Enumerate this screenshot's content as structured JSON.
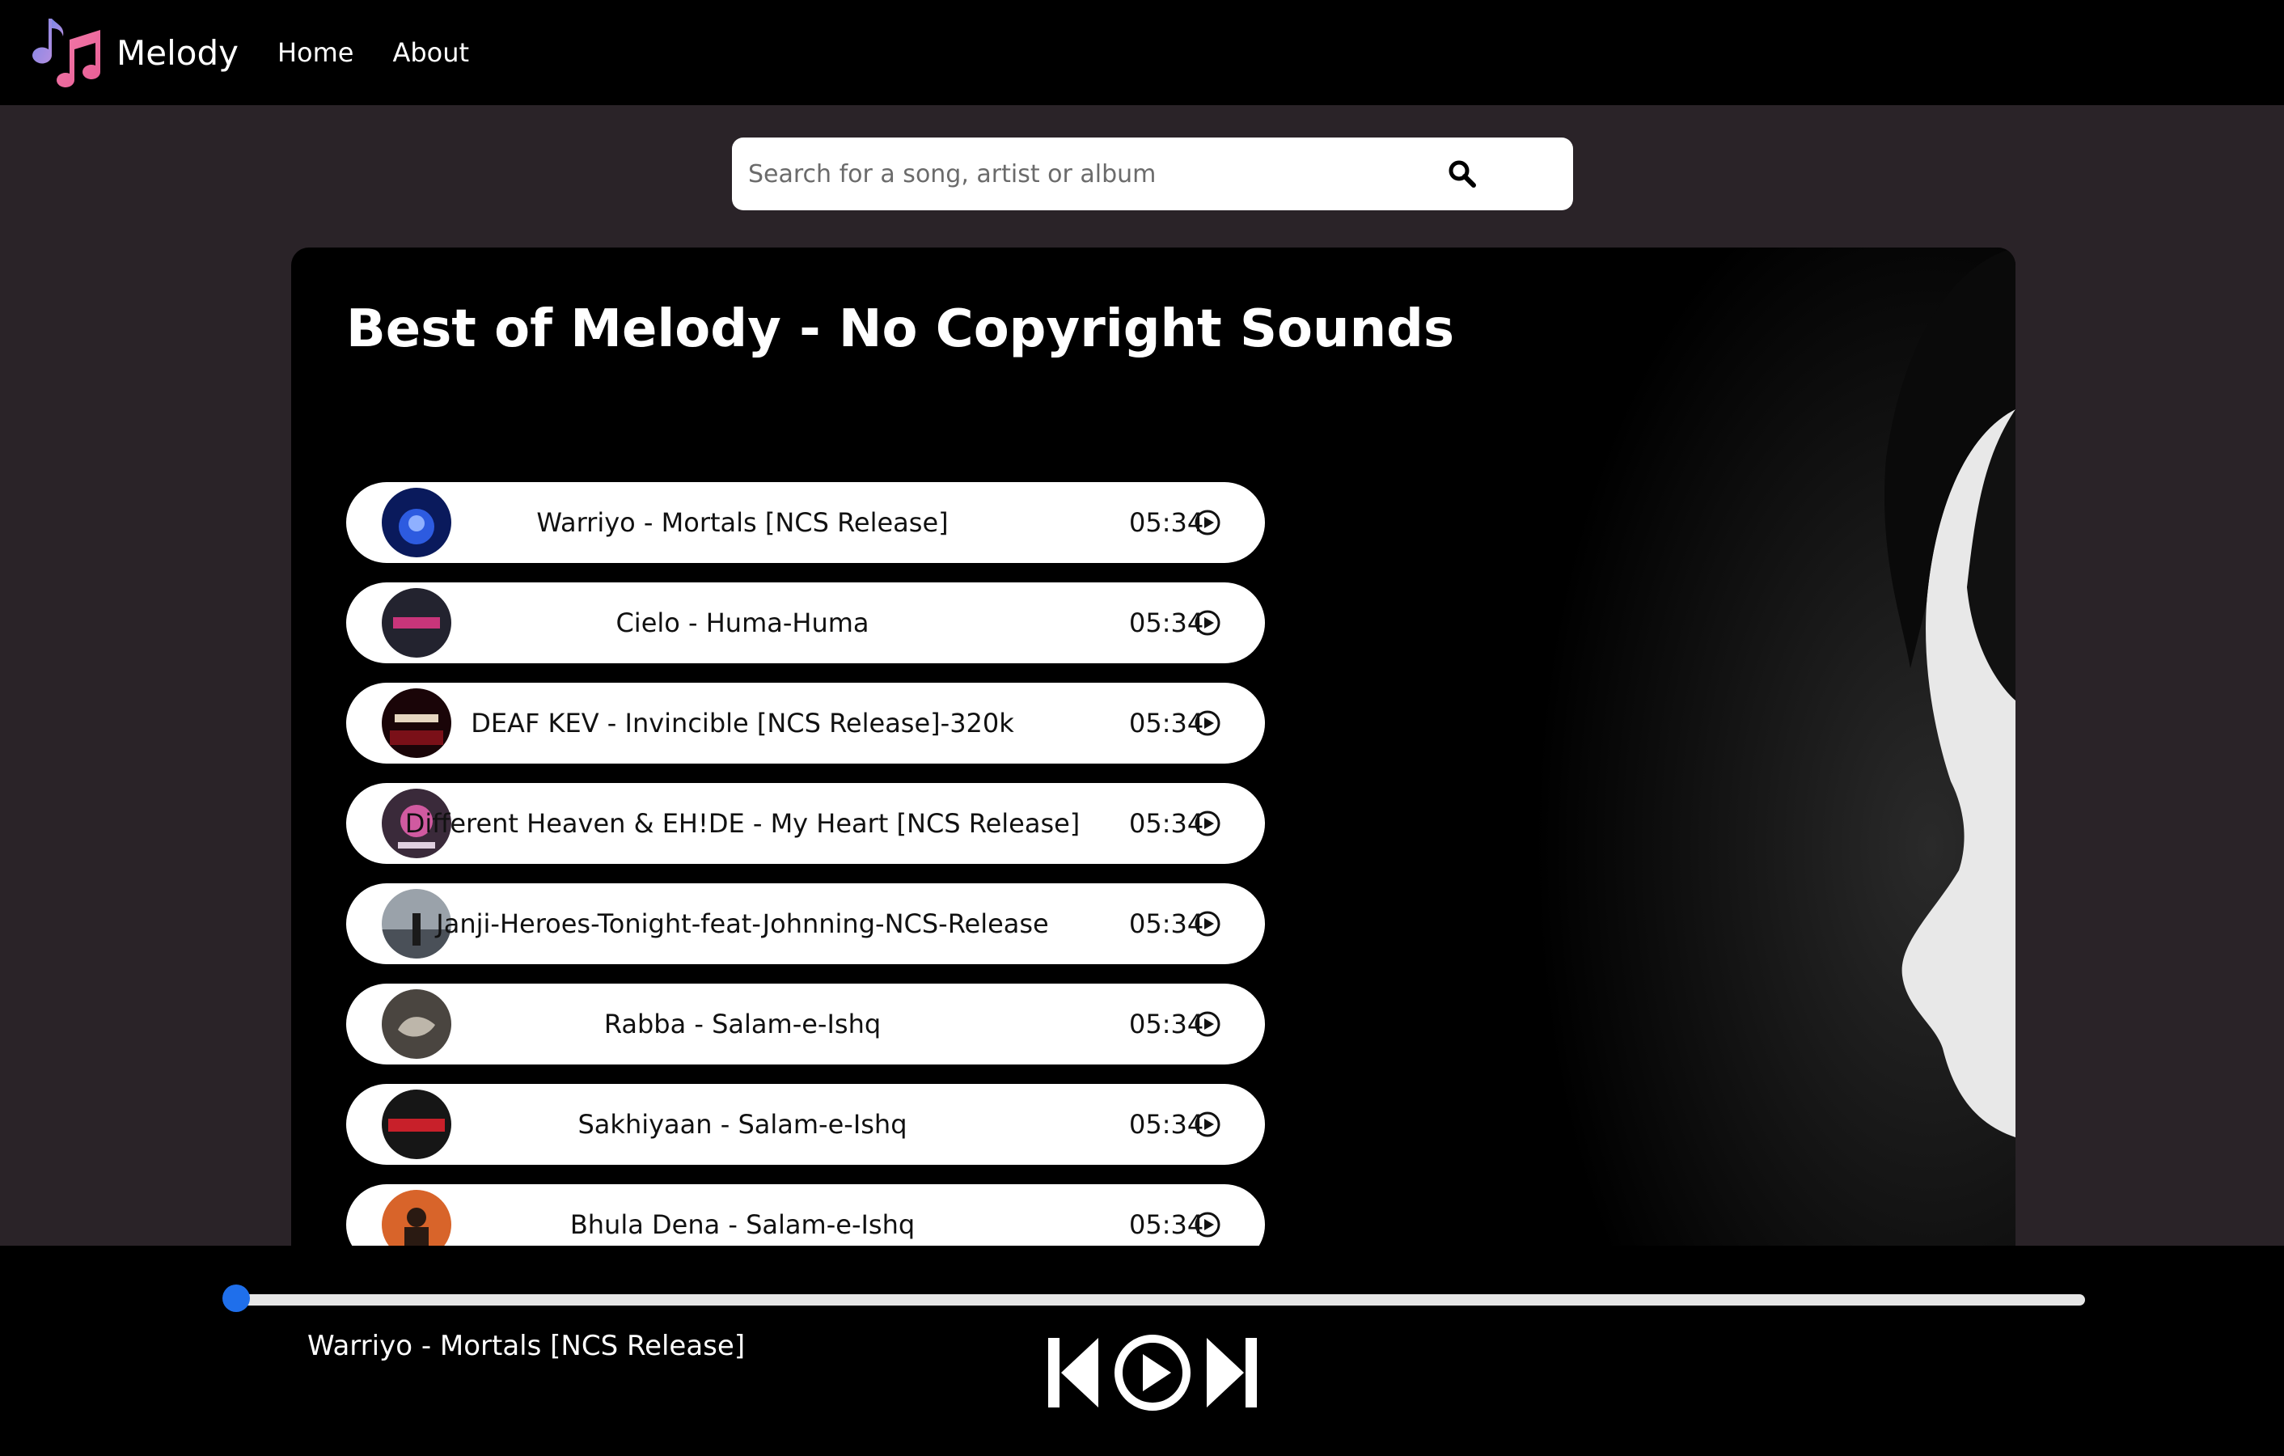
{
  "navbar": {
    "brand": "Melody",
    "links": [
      "Home",
      "About"
    ],
    "logo_icon": "music-notes-icon"
  },
  "search": {
    "placeholder": "Search for a song, artist or album",
    "value": "",
    "icon": "search-icon"
  },
  "playlist": {
    "title": "Best of Melody - No Copyright Sounds",
    "songs": [
      {
        "name": "Warriyo - Mortals [NCS Release]",
        "duration": "05:34",
        "cover_color": "#1f3fa8"
      },
      {
        "name": "Cielo - Huma-Huma",
        "duration": "05:34",
        "cover_color": "#2a2a3a"
      },
      {
        "name": "DEAF KEV - Invincible [NCS Release]-320k",
        "duration": "05:34",
        "cover_color": "#3a0a0e"
      },
      {
        "name": "Different Heaven & EH!DE - My Heart [NCS Release]",
        "duration": "05:34",
        "cover_color": "#5a3a55"
      },
      {
        "name": "Janji-Heroes-Tonight-feat-Johnning-NCS-Release",
        "duration": "05:34",
        "cover_color": "#8a9098"
      },
      {
        "name": "Rabba - Salam-e-Ishq",
        "duration": "05:34",
        "cover_color": "#4a4540"
      },
      {
        "name": "Sakhiyaan - Salam-e-Ishq",
        "duration": "05:34",
        "cover_color": "#1a1a1a"
      },
      {
        "name": "Bhula Dena - Salam-e-Ishq",
        "duration": "05:34",
        "cover_color": "#d8642a"
      }
    ]
  },
  "player": {
    "now_playing": "Warriyo - Mortals [NCS Release]",
    "progress_percent": 0,
    "controls": [
      "previous-icon",
      "play-icon",
      "next-icon"
    ]
  },
  "colors": {
    "page_bg": "#2a2328",
    "navbar_bg": "#000000",
    "accent": "#1f6feb"
  }
}
